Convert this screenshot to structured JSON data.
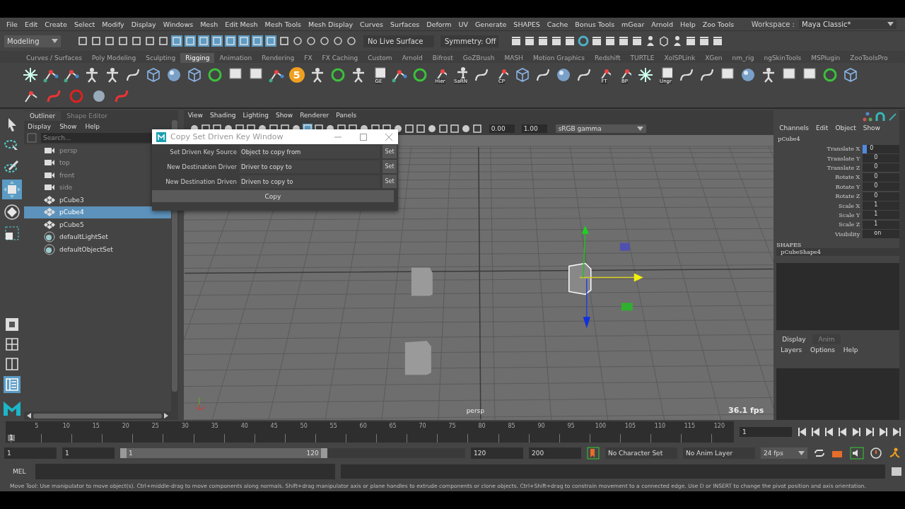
{
  "top_bar": {
    "workspace_label": "Workspace :",
    "workspace": "Maya Classic*"
  },
  "menu_bar": [
    "File",
    "Edit",
    "Create",
    "Select",
    "Modify",
    "Display",
    "Windows",
    "Mesh",
    "Edit Mesh",
    "Mesh Tools",
    "Mesh Display",
    "Curves",
    "Surfaces",
    "Deform",
    "UV",
    "Generate",
    "SHAPES",
    "Cache",
    "Bonus Tools",
    "mGear",
    "Arnold",
    "Help",
    "Zoo Tools"
  ],
  "status_line": {
    "mode": "Modeling",
    "live_surface": "No Live Surface",
    "symmetry": "Symmetry: Off"
  },
  "shelf_tabs": [
    {
      "label": "Curves / Surfaces",
      "selected": false
    },
    {
      "label": "Poly Modeling",
      "selected": false
    },
    {
      "label": "Sculpting",
      "selected": false
    },
    {
      "label": "Rigging",
      "selected": true
    },
    {
      "label": "Animation",
      "selected": false
    },
    {
      "label": "Rendering",
      "selected": false
    },
    {
      "label": "FX",
      "selected": false
    },
    {
      "label": "FX Caching",
      "selected": false
    },
    {
      "label": "Custom",
      "selected": false
    },
    {
      "label": "Arnold",
      "selected": false
    },
    {
      "label": "Bifrost",
      "selected": false
    },
    {
      "label": "GoZBrush",
      "selected": false
    },
    {
      "label": "MASH",
      "selected": false
    },
    {
      "label": "Motion Graphics",
      "selected": false
    },
    {
      "label": "Redshift",
      "selected": false
    },
    {
      "label": "TURTLE",
      "selected": false
    },
    {
      "label": "XolSPLink",
      "selected": false
    },
    {
      "label": "XGen",
      "selected": false
    },
    {
      "label": "nm_rig",
      "selected": false
    },
    {
      "label": "ngSkinTools",
      "selected": false
    },
    {
      "label": "MSPlugin",
      "selected": false
    },
    {
      "label": "ZooToolsPro",
      "selected": false
    }
  ],
  "shelf": [
    {
      "kind": "star"
    },
    {
      "kind": "joint"
    },
    {
      "kind": "joint"
    },
    {
      "kind": "figure"
    },
    {
      "kind": "figure"
    },
    {
      "kind": "curve"
    },
    {
      "kind": "cube"
    },
    {
      "kind": "sphere"
    },
    {
      "kind": "cube"
    },
    {
      "kind": "circle"
    },
    {
      "kind": "square"
    },
    {
      "kind": "square"
    },
    {
      "kind": "joint"
    },
    {
      "kind": "badge",
      "label": "5"
    },
    {
      "kind": "figure"
    },
    {
      "kind": "circle"
    },
    {
      "kind": "figure"
    },
    {
      "kind": "square",
      "label": "GE"
    },
    {
      "kind": "joint"
    },
    {
      "kind": "circle"
    },
    {
      "kind": "joint",
      "label": "Hier"
    },
    {
      "kind": "figure",
      "label": "SaRN"
    },
    {
      "kind": "curve"
    },
    {
      "kind": "joint",
      "label": "CP"
    },
    {
      "kind": "cube"
    },
    {
      "kind": "curve"
    },
    {
      "kind": "sphere"
    },
    {
      "kind": "curve"
    },
    {
      "kind": "joint",
      "label": "FT"
    },
    {
      "kind": "joint",
      "label": "BP"
    },
    {
      "kind": "star"
    },
    {
      "kind": "square",
      "label": "Ungr"
    },
    {
      "kind": "curve"
    },
    {
      "kind": "curve"
    },
    {
      "kind": "square"
    },
    {
      "kind": "sphere"
    },
    {
      "kind": "figure"
    },
    {
      "kind": "square"
    },
    {
      "kind": "square"
    },
    {
      "kind": "circle"
    },
    {
      "kind": "cube"
    }
  ],
  "outliner": {
    "tabs": [
      {
        "label": "Outliner",
        "selected": true
      },
      {
        "label": "Shape Editor",
        "selected": false
      }
    ],
    "menu": [
      "Display",
      "Show",
      "Help"
    ],
    "search_placeholder": "Search...",
    "items": [
      {
        "label": "persp",
        "kind": "camera",
        "hidden": true,
        "selected": false
      },
      {
        "label": "top",
        "kind": "camera",
        "hidden": true,
        "selected": false
      },
      {
        "label": "front",
        "kind": "camera",
        "hidden": true,
        "selected": false
      },
      {
        "label": "side",
        "kind": "camera",
        "hidden": true,
        "selected": false
      },
      {
        "label": "pCube3",
        "kind": "mesh",
        "hidden": false,
        "selected": false
      },
      {
        "label": "pCube4",
        "kind": "mesh",
        "hidden": false,
        "selected": true
      },
      {
        "label": "pCube5",
        "kind": "mesh",
        "hidden": false,
        "selected": false
      },
      {
        "label": "defaultLightSet",
        "kind": "set",
        "hidden": false,
        "selected": false
      },
      {
        "label": "defaultObjectSet",
        "kind": "set",
        "hidden": false,
        "selected": false
      }
    ]
  },
  "viewport": {
    "menu": [
      "View",
      "Shading",
      "Lighting",
      "Show",
      "Renderer",
      "Panels"
    ],
    "exposure": "0.00",
    "gamma": "1.00",
    "color_space": "sRGB gamma",
    "camera": "persp",
    "fps": "36.1 fps"
  },
  "dialog": {
    "title": "Copy Set Driven Key Window",
    "rows": [
      {
        "label": "Set Driven Key Source",
        "placeholder": "Object to copy from",
        "button": "Set"
      },
      {
        "label": "New Destination Driver",
        "placeholder": "Driver to copy to",
        "button": "Set"
      },
      {
        "label": "New Destination Driven",
        "placeholder": "Driven to copy to",
        "button": "Set"
      }
    ],
    "action": "Copy"
  },
  "channel_box": {
    "menu": [
      "Channels",
      "Edit",
      "Object",
      "Show"
    ],
    "object": "pCube4",
    "attributes": [
      {
        "name": "Translate X",
        "value": "0",
        "selected": true
      },
      {
        "name": "Translate Y",
        "value": "0",
        "selected": false
      },
      {
        "name": "Translate Z",
        "value": "0",
        "selected": false
      },
      {
        "name": "Rotate X",
        "value": "0",
        "selected": false
      },
      {
        "name": "Rotate Y",
        "value": "0",
        "selected": false
      },
      {
        "name": "Rotate Z",
        "value": "0",
        "selected": false
      },
      {
        "name": "Scale X",
        "value": "1",
        "selected": false
      },
      {
        "name": "Scale Y",
        "value": "1",
        "selected": false
      },
      {
        "name": "Scale Z",
        "value": "1",
        "selected": false
      },
      {
        "name": "Visibility",
        "value": "on",
        "selected": false
      }
    ],
    "shapes_heading": "SHAPES",
    "shape": "pCubeShape4"
  },
  "layer_editor": {
    "tabs": [
      {
        "label": "Display",
        "selected": true
      },
      {
        "label": "Anim",
        "selected": false
      }
    ],
    "menu": [
      "Layers",
      "Options",
      "Help"
    ]
  },
  "timeline": {
    "ticks": [
      "5",
      "10",
      "15",
      "20",
      "25",
      "30",
      "35",
      "40",
      "45",
      "50",
      "55",
      "60",
      "65",
      "70",
      "75",
      "80",
      "85",
      "90",
      "95",
      "100",
      "105",
      "110",
      "115",
      "120"
    ],
    "current_frame": "1",
    "level": 0,
    "frame_field": "1"
  },
  "range": {
    "start": "1",
    "playback_start": "1",
    "slider_start": "1",
    "slider_end": "120",
    "level": 0.6,
    "playback_end": "120",
    "end": "200",
    "character_set": "No Character Set",
    "anim_layer": "No Anim Layer",
    "fps": "24 fps"
  },
  "command_line": {
    "label": "MEL"
  },
  "help_line": "Move Tool: Use manipulator to move object(s). Ctrl+middle-drag to move components along normals. Shift+drag manipulator axis or plane handles to extrude components or clone objects. Ctrl+Shift+drag to constrain movement to a connected edge. Use D or INSERT to change the pivot position and axis orientation."
}
